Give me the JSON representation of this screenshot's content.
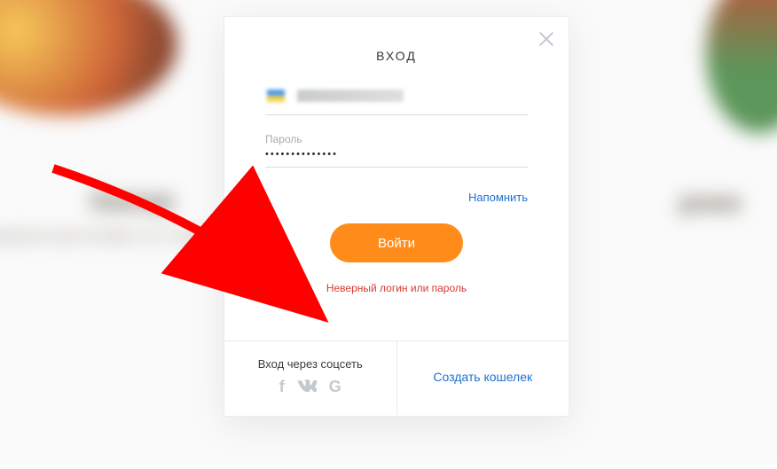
{
  "modal": {
    "title": "ВХОД",
    "login_value": "",
    "password_label": "Пароль",
    "password_masked": "••••••••••••••",
    "remind_label": "Напомнить",
    "submit_label": "Войти",
    "error_message": "Неверный логин или пароль"
  },
  "footer": {
    "social_title": "Вход через соцсеть",
    "create_wallet_label": "Создать кошелек"
  },
  "bg": {
    "headline_left": "Зажар",
    "headline_right": "рнее",
    "subline": "пециально для онлайн                                                                                     сти с каждой покупки!"
  }
}
